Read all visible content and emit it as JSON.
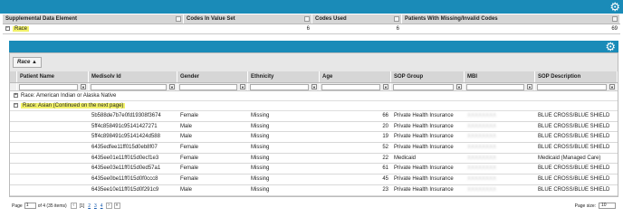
{
  "summary": {
    "headers": [
      "Supplemental Data Element",
      "Codes In Value Set",
      "Codes Used",
      "Patients With Missing/Invalid Codes"
    ],
    "row": {
      "element": "Race",
      "codes_in_value_set": "6",
      "codes_used": "6",
      "patients_missing": "69"
    }
  },
  "group_chip": "Race",
  "columns": [
    "Patient Name",
    "Medisolv Id",
    "Gender",
    "Ethnicity",
    "Age",
    "SOP Group",
    "MBI",
    "SOP Description"
  ],
  "groups": [
    {
      "label": "Race: American Indian or Alaska Native",
      "highlight": false
    },
    {
      "label": "Race: Asian (Continued on the next page)",
      "highlight": true
    }
  ],
  "rows": [
    {
      "name": "",
      "medisolv_id": "5b588de7b7e0fd19308f3674",
      "gender": "Female",
      "ethnicity": "Missing",
      "age": "66",
      "sop_group": "Private Health Insurance",
      "mbi": "XXXXXXXX",
      "sop_desc": "BLUE CROSS/BLUE SHIELD"
    },
    {
      "name": "",
      "medisolv_id": "5ff4c858491c95141427271",
      "gender": "Male",
      "ethnicity": "Missing",
      "age": "20",
      "sop_group": "Private Health Insurance",
      "mbi": "XXXXXXXX",
      "sop_desc": "BLUE CROSS/BLUE SHIELD"
    },
    {
      "name": "",
      "medisolv_id": "5ff4c898491c95141424d588",
      "gender": "Male",
      "ethnicity": "Missing",
      "age": "19",
      "sop_group": "Private Health Insurance",
      "mbi": "XXXXXXXX",
      "sop_desc": "BLUE CROSS/BLUE SHIELD"
    },
    {
      "name": "",
      "medisolv_id": "6435edfee11ff015d0eb8f07",
      "gender": "Female",
      "ethnicity": "Missing",
      "age": "52",
      "sop_group": "Private Health Insurance",
      "mbi": "XXXXXXXX",
      "sop_desc": "BLUE CROSS/BLUE SHIELD"
    },
    {
      "name": "",
      "medisolv_id": "6435ee01e11ff015d0ecf1e3",
      "gender": "Female",
      "ethnicity": "Missing",
      "age": "22",
      "sop_group": "Medicaid",
      "mbi": "XXXXXXXX",
      "sop_desc": "Medicaid (Managed Care)"
    },
    {
      "name": "",
      "medisolv_id": "6435ee03e11ff015d0ed57a1",
      "gender": "Female",
      "ethnicity": "Missing",
      "age": "61",
      "sop_group": "Private Health Insurance",
      "mbi": "XXXXXXXX",
      "sop_desc": "BLUE CROSS/BLUE SHIELD"
    },
    {
      "name": "",
      "medisolv_id": "6435ee0be11ff015d0f0ccc8",
      "gender": "Female",
      "ethnicity": "Missing",
      "age": "45",
      "sop_group": "Private Health Insurance",
      "mbi": "XXXXXXXX",
      "sop_desc": "BLUE CROSS/BLUE SHIELD"
    },
    {
      "name": "",
      "medisolv_id": "6435ee10e11ff015d0f291c9",
      "gender": "Male",
      "ethnicity": "Missing",
      "age": "23",
      "sop_group": "Private Health Insurance",
      "mbi": "XXXXXXXX",
      "sop_desc": "BLUE CROSS/BLUE SHIELD"
    }
  ],
  "pager": {
    "page_label": "Page",
    "page_value": "1",
    "of_text": "of 4 (35 items)",
    "current": "[1]",
    "pages": [
      "2",
      "3",
      "4"
    ],
    "page_size_label": "Page size:",
    "page_size": "10"
  },
  "colors": {
    "accent": "#1a8bb8",
    "highlight": "#f2f26a"
  },
  "icons": {
    "gear": "gear-icon",
    "filter": "filter-icon"
  }
}
